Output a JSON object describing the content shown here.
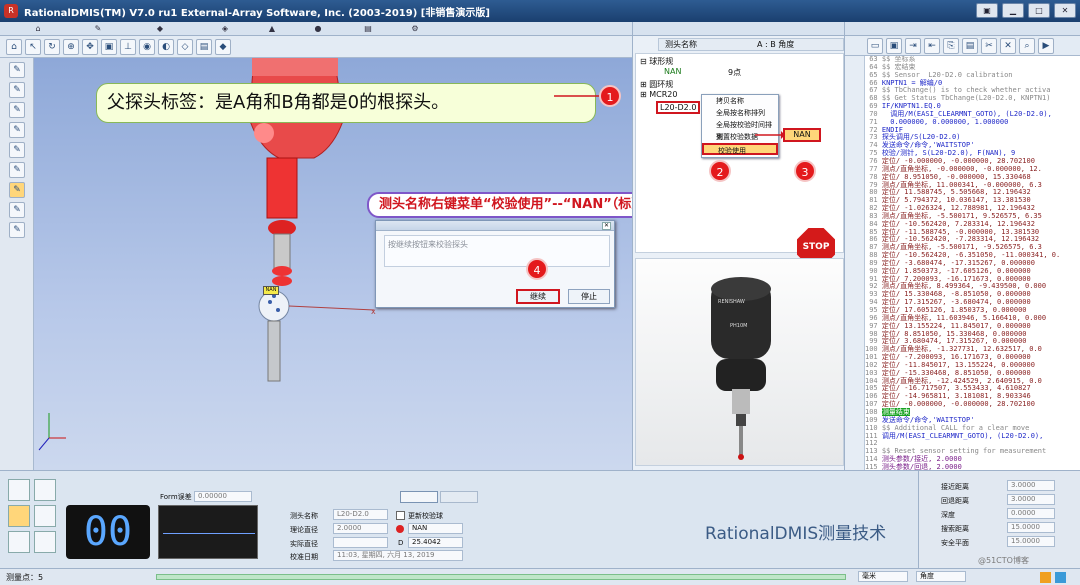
{
  "title_bar": {
    "title": "RationalDMIS(TM) V7.0 ru1   External-Array Software, Inc. (2003-2019) [非销售演示版]"
  },
  "callouts": {
    "parent_probe_label": "父探头标签：是A角和B角都是0的根探头。",
    "right_click_menu": "测头名称右键菜单“校验使用”--“NAN”（标准球）",
    "badge_1": "1",
    "badge_2": "2",
    "badge_3": "3",
    "badge_4": "4"
  },
  "viewport": {
    "probe_tag": "NAN"
  },
  "dialog": {
    "message": "按继续按钮来校验探头",
    "continue_label": "继续",
    "stop_label": "停止"
  },
  "probe_panel": {
    "col_name": "测头名称",
    "col_angle": "A : B 角度",
    "tree": [
      {
        "label": "球形规"
      },
      {
        "label": "NAN",
        "angle": "9点"
      },
      {
        "label": "圆环规"
      },
      {
        "label": "MCR20"
      },
      {
        "label": "L20-D2.0"
      }
    ],
    "context_menu": [
      "拷贝名称",
      "全局按名称排列",
      "全局按校验时间排列",
      "重置校验数据",
      "校验使用"
    ],
    "submenu_value": "NAN",
    "stop_sign": "STOP",
    "photo_brand": "RENISHAW",
    "photo_model": "PH10M"
  },
  "code_lines": [
    {
      "n": "63",
      "t": "$$ 坐标系",
      "c": "c-gray"
    },
    {
      "n": "64",
      "t": "$$ 宏结束",
      "c": "c-gray"
    },
    {
      "n": "65",
      "t": "$$ Sensor  L20-D2.0 calibration",
      "c": "c-gray"
    },
    {
      "n": "66",
      "t": "KNPTN1 = 解编/0",
      "c": "c-blue"
    },
    {
      "n": "67",
      "t": "$$ TbChange() is to check whether activa",
      "c": "c-gray"
    },
    {
      "n": "68",
      "t": "$$ Get Status TbChange(L20-D2.0, KNPTN1)",
      "c": "c-gray"
    },
    {
      "n": "69",
      "t": "IF/KNPTN1.EQ.0",
      "c": "c-blue"
    },
    {
      "n": "70",
      "t": "  调用/M(EASI_CLEARMNT_GOTO), (L20-D2.0),",
      "c": "c-blue"
    },
    {
      "n": "71",
      "t": "  0.000000, 0.000000, 1.000000",
      "c": "c-blue"
    },
    {
      "n": "72",
      "t": "ENDIF",
      "c": "c-blue"
    },
    {
      "n": "73",
      "t": "探头调用/S(L20-D2.0)",
      "c": "c-blue"
    },
    {
      "n": "74",
      "t": "发送命令/命令,'WAITSTOP'",
      "c": "c-blue"
    },
    {
      "n": "75",
      "t": "校验/测针, S(L20-D2.0), F(NAN), 9",
      "c": "c-blue"
    },
    {
      "n": "76",
      "t": "定位/ -0.000000, -0.000000, 28.702100",
      "c": "c-brown"
    },
    {
      "n": "77",
      "t": "测点/直角坐标, -0.000000, -0.000000, 12.",
      "c": "c-brown"
    },
    {
      "n": "78",
      "t": "定位/ 8.951050, -0.000000, 15.330468",
      "c": "c-brown"
    },
    {
      "n": "79",
      "t": "测点/直角坐标, 11.000341, -0.000000, 6.3",
      "c": "c-brown"
    },
    {
      "n": "80",
      "t": "定位/ 11.588745, 5.505668, 12.196432",
      "c": "c-brown"
    },
    {
      "n": "81",
      "t": "定位/ 5.794372, 10.036147, 13.381530",
      "c": "c-brown"
    },
    {
      "n": "82",
      "t": "定位/ -1.026324, 12.788981, 12.196432",
      "c": "c-brown"
    },
    {
      "n": "83",
      "t": "测点/直角坐标, -5.500171, 9.526575, 6.35",
      "c": "c-brown"
    },
    {
      "n": "84",
      "t": "定位/ -10.562420, 7.283314, 12.196432",
      "c": "c-brown"
    },
    {
      "n": "85",
      "t": "定位/ -11.588745, -0.000000, 13.381530",
      "c": "c-brown"
    },
    {
      "n": "86",
      "t": "定位/ -10.562420, -7.283314, 12.196432",
      "c": "c-brown"
    },
    {
      "n": "87",
      "t": "测点/直角坐标, -5.500171, -9.526575, 6.3",
      "c": "c-brown"
    },
    {
      "n": "88",
      "t": "定位/ -10.562420, -6.351050, -11.000341, 0.",
      "c": "c-brown"
    },
    {
      "n": "89",
      "t": "定位/ -3.680474, -17.315267, 0.000000",
      "c": "c-brown"
    },
    {
      "n": "90",
      "t": "定位/ 1.850373, -17.605126, 0.000000",
      "c": "c-brown"
    },
    {
      "n": "91",
      "t": "定位/ 7.200093, -16.171673, 0.000000",
      "c": "c-brown"
    },
    {
      "n": "92",
      "t": "测点/直角坐标, 8.499364, -9.439500, 0.000",
      "c": "c-brown"
    },
    {
      "n": "93",
      "t": "定位/ 15.330468, -8.851050, 0.000000",
      "c": "c-brown"
    },
    {
      "n": "94",
      "t": "定位/ 17.315267, -3.680474, 0.000000",
      "c": "c-brown"
    },
    {
      "n": "95",
      "t": "定位/ 17.605126, 1.850373, 0.000000",
      "c": "c-brown"
    },
    {
      "n": "96",
      "t": "测点/直角坐标, 11.603946, 5.166410, 0.000",
      "c": "c-brown"
    },
    {
      "n": "97",
      "t": "定位/ 13.155224, 11.845017, 0.000000",
      "c": "c-brown"
    },
    {
      "n": "98",
      "t": "定位/ 8.851050, 15.330468, 0.000000",
      "c": "c-brown"
    },
    {
      "n": "99",
      "t": "定位/ 3.680474, 17.315267, 0.000000",
      "c": "c-brown"
    },
    {
      "n": "100",
      "t": "测点/直角坐标, -1.327731, 12.632517, 0.0",
      "c": "c-brown"
    },
    {
      "n": "101",
      "t": "定位/ -7.200093, 16.171673, 0.000000",
      "c": "c-brown"
    },
    {
      "n": "102",
      "t": "定位/ -11.845017, 13.155224, 0.000000",
      "c": "c-brown"
    },
    {
      "n": "103",
      "t": "定位/ -15.330468, 8.851050, 0.000000",
      "c": "c-brown"
    },
    {
      "n": "104",
      "t": "测点/直角坐标, -12.424529, 2.640915, 0.0",
      "c": "c-brown"
    },
    {
      "n": "105",
      "t": "定位/ -16.717507, 3.553433, 4.610827",
      "c": "c-brown"
    },
    {
      "n": "106",
      "t": "定位/ -14.965811, 3.181081, 8.903346",
      "c": "c-brown"
    },
    {
      "n": "107",
      "t": "定位/ -0.000000, -0.000000, 28.702100",
      "c": "c-brown"
    },
    {
      "n": "108",
      "t": "测量结束",
      "c": "c-green-bg"
    },
    {
      "n": "109",
      "t": "发送命令/命令,'WAITSTOP'",
      "c": "c-blue"
    },
    {
      "n": "110",
      "t": "$$ Additional CALL for a clear move",
      "c": "c-gray"
    },
    {
      "n": "111",
      "t": "调用/M(EASI_CLEARMNT_GOTO), (L20-D2.0),",
      "c": "c-blue"
    },
    {
      "n": "112",
      "t": "",
      "c": "c-blue"
    },
    {
      "n": "113",
      "t": "$$ Reset sensor setting for measurement",
      "c": "c-gray"
    },
    {
      "n": "114",
      "t": "测头参数/接近, 2.0000",
      "c": "c-purple"
    },
    {
      "n": "115",
      "t": "测头参数/回退, 2.0000",
      "c": "c-purple"
    },
    {
      "n": "116",
      "t": "测头参数/搜索, 10.0000",
      "c": "c-purple"
    },
    {
      "n": "117",
      "t": "测头参数/安全距离, 15.0000",
      "c": "c-purple"
    }
  ],
  "bottom": {
    "form_error_label": "Form误差",
    "form_error_value": "0.00000",
    "big_readout": "00",
    "probe_name_label": "测头名称",
    "probe_name_value": "L20-D2.0",
    "theory_diam_label": "理论直径",
    "theory_diam_value": "2.0000",
    "actual_diam_label": "实际直径",
    "calib_date_label": "校准日期",
    "calib_date_value": "11:03, 星期四, 六月 13, 2019",
    "checkbox_label": "更新校验球",
    "ref_sphere_value": "NAN",
    "d_label": "D",
    "d_value": "25.4042",
    "approach_label": "接近距离",
    "approach_value": "3.0000",
    "retract_label": "回退距离",
    "retract_value": "3.0000",
    "depth_label": "深度",
    "depth_value": "0.0000",
    "search_label": "搜索距离",
    "search_value": "15.0000",
    "clearance_label": "安全平面",
    "clearance_value": "15.0000"
  },
  "status": {
    "measure_points": "测量点：5",
    "unit_select": "毫米",
    "angle_select": "角度"
  },
  "watermark": {
    "title": "RationalDMIS测量技术",
    "sub": "@51CTO博客"
  },
  "colors": {
    "callout_red": "#d0161f",
    "code_green": "#19a323",
    "badge_red": "#e41a1c"
  }
}
